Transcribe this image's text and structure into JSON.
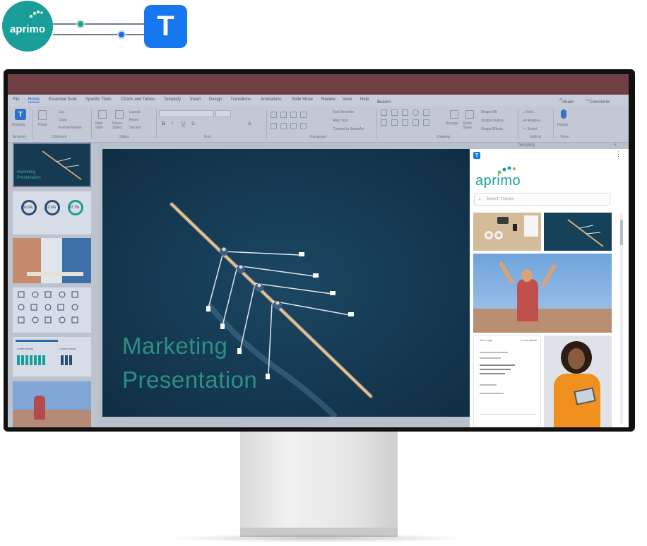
{
  "brand": {
    "left_logo_text": "aprimo",
    "badge_letter": "T",
    "teal": "#1a9e9a",
    "blue": "#1677ef"
  },
  "ppt": {
    "menu": [
      "File",
      "Home",
      "Essential Tools",
      "Specific Tools",
      "Charts and Tables",
      "Templafy",
      "Insert",
      "Design",
      "Transitions",
      "Animations",
      "Slide Show",
      "Review",
      "View",
      "Help"
    ],
    "search_label": "Search",
    "share_label": "Share",
    "comments_label": "Comments",
    "ribbon": {
      "templafy_btn": "Templafy",
      "paste_btn": "Paste",
      "cut_btn": "Cut",
      "copy_btn": "Copy",
      "format_painter_btn": "Format Painter",
      "new_slide_btn": "New Slide",
      "reuse_slides_btn": "Reuse Slides",
      "layout_btn": "Layout",
      "reset_btn": "Reset",
      "section_btn": "Section",
      "text_direction_btn": "Text Direction",
      "align_text_btn": "Align Text",
      "convert_smartart_btn": "Convert to SmartArt",
      "arrange_btn": "Arrange",
      "quick_styles_btn": "Quick Styles",
      "shape_fill_btn": "Shape Fill",
      "shape_outline_btn": "Shape Outline",
      "shape_effects_btn": "Shape Effects",
      "find_btn": "Find",
      "replace_btn": "Replace",
      "select_btn": "Select",
      "dictate_btn": "Dictate",
      "group_labels": [
        "Templafy",
        "Clipboard",
        "Slides",
        "Font",
        "Paragraph",
        "Drawing",
        "Editing",
        "Voice"
      ],
      "pane_label": "Templafy"
    },
    "thumbnails": {
      "slide1_title": "Marketing Presentation",
      "slide2_stats": [
        "55.6%",
        "12.6%",
        "97.7%"
      ],
      "slide5_label_left": "Lorem ipsum",
      "slide5_label_right": "Lorem ipsum"
    },
    "slide": {
      "title_line1": "Marketing",
      "title_line2": "Presentation"
    },
    "panel": {
      "logo": "aprimo",
      "search_placeholder": "Search images",
      "more_icon": "⋮",
      "doc_heading": "Your Logo",
      "doc_right_text": "Lorem ipsum"
    }
  }
}
